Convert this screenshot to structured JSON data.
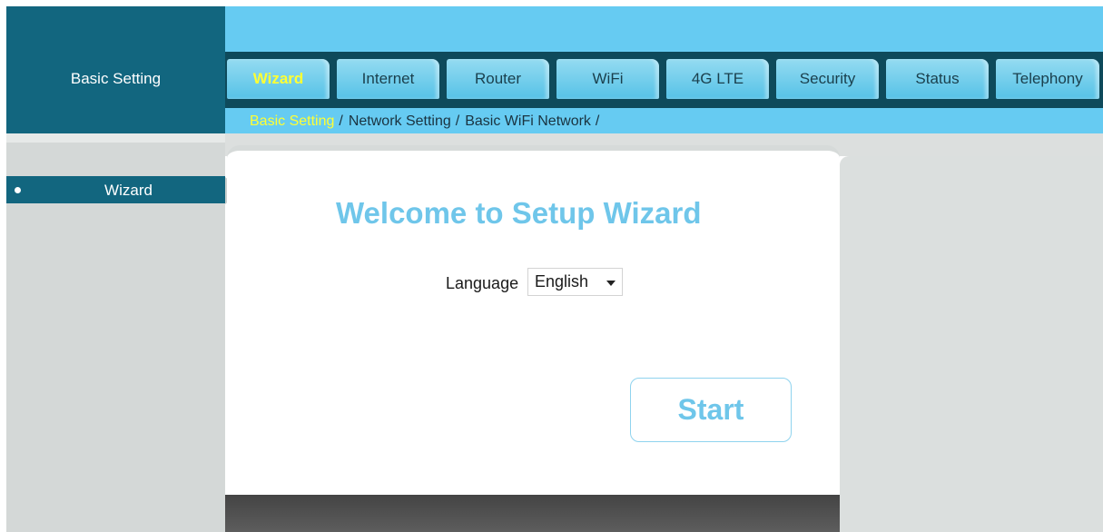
{
  "header": {
    "section_title": "Basic Setting"
  },
  "tabs": [
    {
      "label": "Wizard",
      "active": true
    },
    {
      "label": "Internet",
      "active": false
    },
    {
      "label": "Router",
      "active": false
    },
    {
      "label": "WiFi",
      "active": false
    },
    {
      "label": "4G LTE",
      "active": false
    },
    {
      "label": "Security",
      "active": false
    },
    {
      "label": "Status",
      "active": false
    },
    {
      "label": "Telephony",
      "active": false
    }
  ],
  "breadcrumb": [
    {
      "label": "Basic Setting",
      "active": true
    },
    {
      "label": "Network Setting",
      "active": false
    },
    {
      "label": "Basic WiFi Network",
      "active": false
    }
  ],
  "breadcrumb_separator": "/",
  "sidebar": {
    "items": [
      {
        "label": "Wizard",
        "selected": true
      }
    ]
  },
  "main": {
    "title": "Welcome to Setup Wizard",
    "language_label": "Language",
    "language_value": "English",
    "start_label": "Start"
  },
  "colors": {
    "header_dark": "#12667f",
    "header_light": "#66cbf2",
    "active_highlight": "#ffff33",
    "accent_text": "#6fc6ea"
  }
}
